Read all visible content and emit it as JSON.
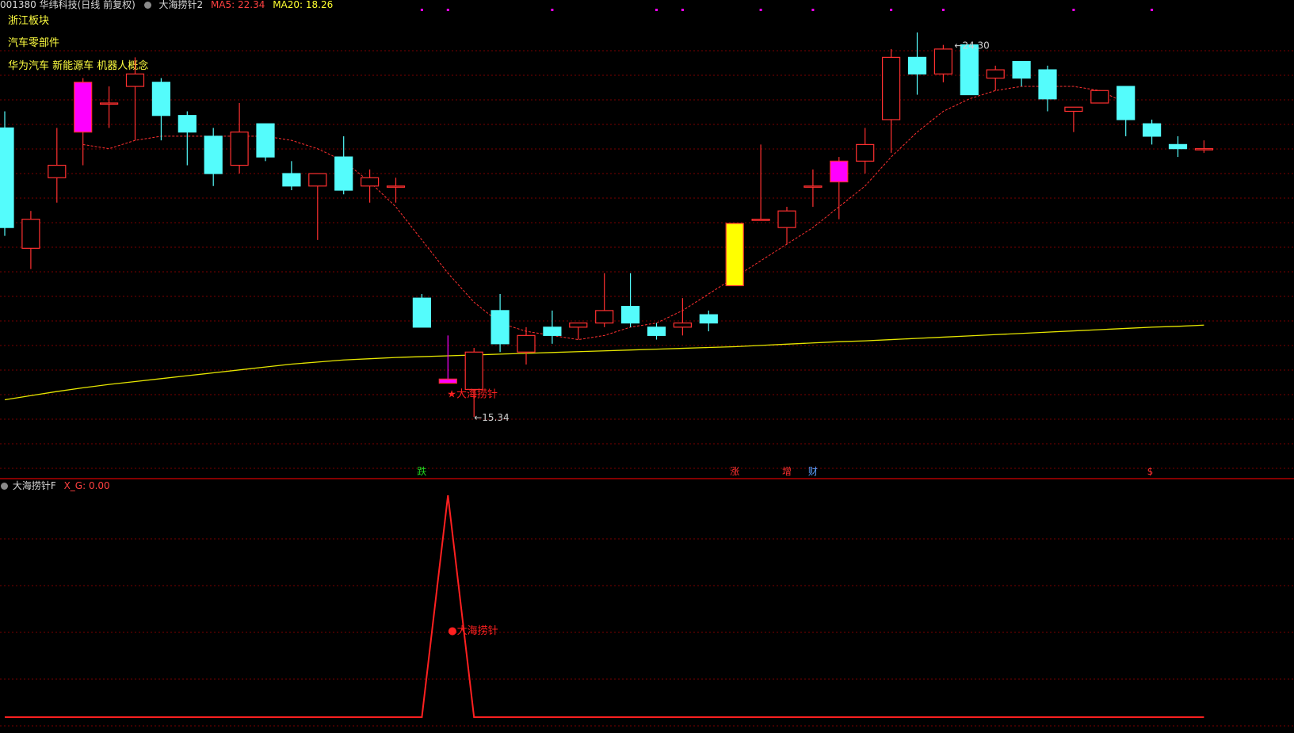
{
  "header": {
    "stock": "001380 华纬科技(日线 前复权)",
    "indicator": "大海捞针2",
    "ma5_label": "MA5: 22.34",
    "ma20_label": "MA20: 18.26"
  },
  "concepts": [
    "浙江板块",
    "汽车零部件",
    "华为汽车 新能源车 机器人概念"
  ],
  "sub_panel": {
    "name": "大海捞针F",
    "value_label": "X_G: 0.00"
  },
  "colors": {
    "up": "#ff3030",
    "down": "#54fcfc",
    "ma5": "#ff3030",
    "ma20": "#e6e600",
    "grid": "#7a0000",
    "divider": "#b00000",
    "signal": "#ff2020",
    "magenta": "#ff00ff",
    "yellow_candle": "#ffff00"
  },
  "chart_data": [
    {
      "type": "candlestick",
      "title": "",
      "ylim": [
        14.5,
        25.0
      ],
      "candles": [
        {
          "o": 22.3,
          "c": 19.9,
          "h": 22.7,
          "l": 19.7
        },
        {
          "o": 19.4,
          "c": 20.1,
          "h": 20.3,
          "l": 18.9
        },
        {
          "o": 21.1,
          "c": 21.4,
          "h": 22.3,
          "l": 20.5
        },
        {
          "o": 22.2,
          "c": 23.4,
          "h": 23.5,
          "l": 21.4,
          "color": "magenta"
        },
        {
          "o": 22.9,
          "c": 22.9,
          "h": 23.3,
          "l": 22.3
        },
        {
          "o": 23.3,
          "c": 23.6,
          "h": 24.0,
          "l": 22.0
        },
        {
          "o": 23.4,
          "c": 22.6,
          "h": 23.5,
          "l": 22.0
        },
        {
          "o": 22.6,
          "c": 22.2,
          "h": 22.7,
          "l": 21.4
        },
        {
          "o": 22.1,
          "c": 21.2,
          "h": 22.3,
          "l": 20.9
        },
        {
          "o": 21.4,
          "c": 22.2,
          "h": 22.9,
          "l": 21.2
        },
        {
          "o": 22.4,
          "c": 21.6,
          "h": 22.4,
          "l": 21.5
        },
        {
          "o": 21.2,
          "c": 20.9,
          "h": 21.5,
          "l": 20.8
        },
        {
          "o": 20.9,
          "c": 21.2,
          "h": 21.2,
          "l": 19.6
        },
        {
          "o": 21.6,
          "c": 20.8,
          "h": 22.1,
          "l": 20.7
        },
        {
          "o": 20.9,
          "c": 21.1,
          "h": 21.3,
          "l": 20.5
        },
        {
          "o": 20.9,
          "c": 20.9,
          "h": 21.1,
          "l": 20.5
        },
        {
          "o": 18.2,
          "c": 17.5,
          "h": 18.3,
          "l": null
        },
        {
          "o": 16.15,
          "c": 16.25,
          "h": 17.3,
          "l": 16.15,
          "color": "magenta"
        },
        {
          "o": 16.0,
          "c": 16.9,
          "h": 17.0,
          "l": 15.34
        },
        {
          "o": 17.9,
          "c": 17.1,
          "h": 18.3,
          "l": 16.9
        },
        {
          "o": 16.9,
          "c": 17.3,
          "h": 17.5,
          "l": 16.6
        },
        {
          "o": 17.5,
          "c": 17.3,
          "h": 17.9,
          "l": 17.1
        },
        {
          "o": 17.5,
          "c": 17.6,
          "h": 17.6,
          "l": 17.2
        },
        {
          "o": 17.6,
          "c": 17.9,
          "h": 18.8,
          "l": 17.5
        },
        {
          "o": 18.0,
          "c": 17.6,
          "h": 18.8,
          "l": 17.5
        },
        {
          "o": 17.5,
          "c": 17.3,
          "h": 17.6,
          "l": 17.2
        },
        {
          "o": 17.5,
          "c": 17.6,
          "h": 18.2,
          "l": 17.3
        },
        {
          "o": 17.8,
          "c": 17.6,
          "h": 17.9,
          "l": 17.4
        },
        {
          "o": 18.5,
          "c": 20.0,
          "h": 20.0,
          "l": 18.5,
          "color": "yellow"
        },
        {
          "o": 20.1,
          "c": 20.1,
          "h": 21.9,
          "l": 20.1
        },
        {
          "o": 19.9,
          "c": 20.3,
          "h": 20.4,
          "l": 19.5
        },
        {
          "o": 20.9,
          "c": 20.9,
          "h": 21.3,
          "l": 20.4
        },
        {
          "o": 21.0,
          "c": 21.5,
          "h": 21.6,
          "l": 20.1,
          "color": "magenta"
        },
        {
          "o": 21.5,
          "c": 21.9,
          "h": 22.3,
          "l": 21.2
        },
        {
          "o": 22.5,
          "c": 24.0,
          "h": 24.2,
          "l": 21.7
        },
        {
          "o": 24.0,
          "c": 23.6,
          "h": 24.6,
          "l": 23.1
        },
        {
          "o": 23.6,
          "c": 24.2,
          "h": 24.3,
          "l": 23.4
        },
        {
          "o": 24.3,
          "c": 23.1,
          "h": 24.3,
          "l": 23.1
        },
        {
          "o": 23.5,
          "c": 23.7,
          "h": 23.8,
          "l": 23.2
        },
        {
          "o": 23.9,
          "c": 23.5,
          "h": 23.9,
          "l": 23.3
        },
        {
          "o": 23.7,
          "c": 23.0,
          "h": 23.8,
          "l": 22.7
        },
        {
          "o": 22.7,
          "c": 22.8,
          "h": 22.8,
          "l": 22.2
        },
        {
          "o": 22.9,
          "c": 23.2,
          "h": 23.2,
          "l": 22.9
        },
        {
          "o": 23.3,
          "c": 22.5,
          "h": 23.3,
          "l": 22.1
        },
        {
          "o": 22.4,
          "c": 22.1,
          "h": 22.5,
          "l": 21.9
        },
        {
          "o": 21.9,
          "c": 21.8,
          "h": 22.1,
          "l": 21.6
        },
        {
          "o": 21.8,
          "c": 21.8,
          "h": 22.0,
          "l": 21.7
        }
      ],
      "ma5": [
        null,
        null,
        null,
        21.9,
        21.8,
        22.0,
        22.1,
        22.1,
        22.1,
        22.1,
        22.1,
        22.0,
        21.8,
        21.5,
        21.0,
        20.4,
        19.6,
        18.8,
        18.1,
        17.6,
        17.4,
        17.3,
        17.2,
        17.3,
        17.5,
        17.6,
        17.9,
        18.3,
        18.7,
        19.1,
        19.5,
        19.9,
        20.4,
        20.9,
        21.6,
        22.2,
        22.7,
        23.0,
        23.2,
        23.3,
        23.3,
        23.3,
        23.2,
        22.9
      ],
      "ma20": [
        15.75,
        15.85,
        15.95,
        16.04,
        16.12,
        16.19,
        16.26,
        16.33,
        16.4,
        16.47,
        16.54,
        16.61,
        16.66,
        16.71,
        16.74,
        16.77,
        16.79,
        16.81,
        16.83,
        16.85,
        16.87,
        16.89,
        16.91,
        16.93,
        16.95,
        16.97,
        16.99,
        17.01,
        17.03,
        17.06,
        17.09,
        17.12,
        17.15,
        17.17,
        17.2,
        17.23,
        17.26,
        17.29,
        17.32,
        17.35,
        17.38,
        17.41,
        17.44,
        17.47,
        17.5,
        17.52,
        17.55
      ],
      "annotations": [
        {
          "text": "24.30",
          "index": 36,
          "value": 24.3
        },
        {
          "text": "15.34",
          "index": 18,
          "value": 15.34
        },
        {
          "text": "★大海捞针",
          "index": 17,
          "value": 16.15
        }
      ],
      "bottom_markers": [
        {
          "text": "跌",
          "index": 16,
          "color": "#20d020"
        },
        {
          "text": "涨",
          "index": 28,
          "color": "#ff3030"
        },
        {
          "text": "增",
          "index": 30,
          "color": "#ff3030"
        },
        {
          "text": "财",
          "index": 31,
          "color": "#5aa0ff"
        },
        {
          "text": "$",
          "index": 44,
          "color": "#ff3030"
        }
      ]
    },
    {
      "type": "line",
      "title": "",
      "series": [
        {
          "name": "X_G",
          "x": [
            0,
            16,
            17,
            18,
            46
          ],
          "values": [
            0,
            0,
            1,
            0,
            0
          ]
        }
      ],
      "annotations": [
        {
          "text": "●大海捞针",
          "index": 17
        }
      ]
    }
  ]
}
